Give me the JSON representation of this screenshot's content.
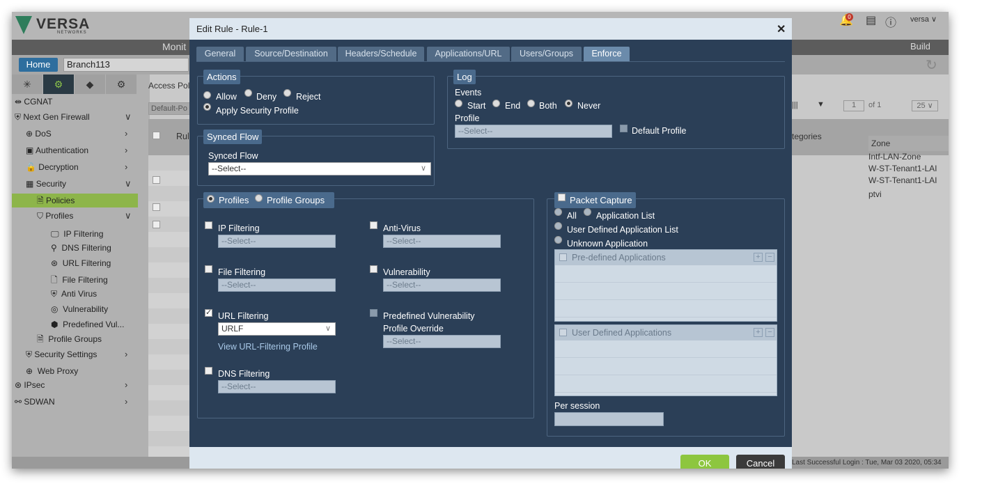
{
  "brand": {
    "name": "VERSA",
    "sub": "NETWORKS"
  },
  "topbar": {
    "notification_count": "0",
    "user": "versa ∨"
  },
  "nav": {
    "monitor": "Monit",
    "build": "Build"
  },
  "crumb": {
    "home": "Home",
    "appliance": "Branch113"
  },
  "sidebar": {
    "items": [
      {
        "label": "CGNAT"
      },
      {
        "label": "Next Gen Firewall"
      },
      {
        "label": "DoS"
      },
      {
        "label": "Authentication"
      },
      {
        "label": "Decryption"
      },
      {
        "label": "Security"
      },
      {
        "label": "Policies"
      },
      {
        "label": "Profiles"
      },
      {
        "label": "IP Filtering"
      },
      {
        "label": "DNS Filtering"
      },
      {
        "label": "URL Filtering"
      },
      {
        "label": "File Filtering"
      },
      {
        "label": "Anti Virus"
      },
      {
        "label": "Vulnerability"
      },
      {
        "label": "Predefined Vul..."
      },
      {
        "label": "Profile Groups"
      },
      {
        "label": "Security Settings"
      },
      {
        "label": "Web Proxy"
      },
      {
        "label": "IPsec"
      },
      {
        "label": "SDWAN"
      }
    ]
  },
  "main": {
    "access_label": "Access Pol",
    "default_tab": "Default-Po",
    "rule_col": "Rul",
    "categories_col": "tegories",
    "zone_col": "Zone",
    "zone_values": [
      "Intf-LAN-Zone",
      "W-ST-Tenant1-LAI",
      "W-ST-Tenant1-LAI"
    ],
    "zone_row2": "ptvi",
    "pager": {
      "page": "1",
      "of": "of 1",
      "size": "25 ∨"
    },
    "last_login": "Last Successful Login : Tue, Mar 03 2020, 05:34"
  },
  "modal": {
    "title": "Edit Rule - Rule-1",
    "tabs": [
      "General",
      "Source/Destination",
      "Headers/Schedule",
      "Applications/URL",
      "Users/Groups",
      "Enforce"
    ],
    "actions": {
      "legend": "Actions",
      "allow": "Allow",
      "deny": "Deny",
      "reject": "Reject",
      "apply": "Apply Security Profile"
    },
    "log": {
      "legend": "Log",
      "events": "Events",
      "start": "Start",
      "end": "End",
      "both": "Both",
      "never": "Never",
      "profile": "Profile",
      "profile_placeholder": "--Select--",
      "default_profile": "Default Profile"
    },
    "synced": {
      "legend": "Synced Flow",
      "label": "Synced Flow",
      "value": "--Select--"
    },
    "profiles": {
      "profiles_label": "Profiles",
      "groups_label": "Profile Groups",
      "ip": "IP Filtering",
      "ip_value": "--Select--",
      "file": "File Filtering",
      "file_value": "--Select--",
      "url": "URL Filtering",
      "url_value": "URLF",
      "url_link": "View URL-Filtering Profile",
      "dns": "DNS Filtering",
      "dns_value": "--Select--",
      "av": "Anti-Virus",
      "av_value": "--Select--",
      "vuln": "Vulnerability",
      "vuln_value": "--Select--",
      "pvo1": "Predefined Vulnerability",
      "pvo2": "Profile Override",
      "pvo_value": "--Select--"
    },
    "capture": {
      "legend": "Packet Capture",
      "all": "All",
      "app_list": "Application List",
      "user_defined": "User Defined Application List",
      "unknown": "Unknown Application",
      "predefined_header": "Pre-defined Applications",
      "user_header": "User Defined Applications",
      "per_session": "Per session"
    },
    "ok": "OK",
    "cancel": "Cancel"
  }
}
